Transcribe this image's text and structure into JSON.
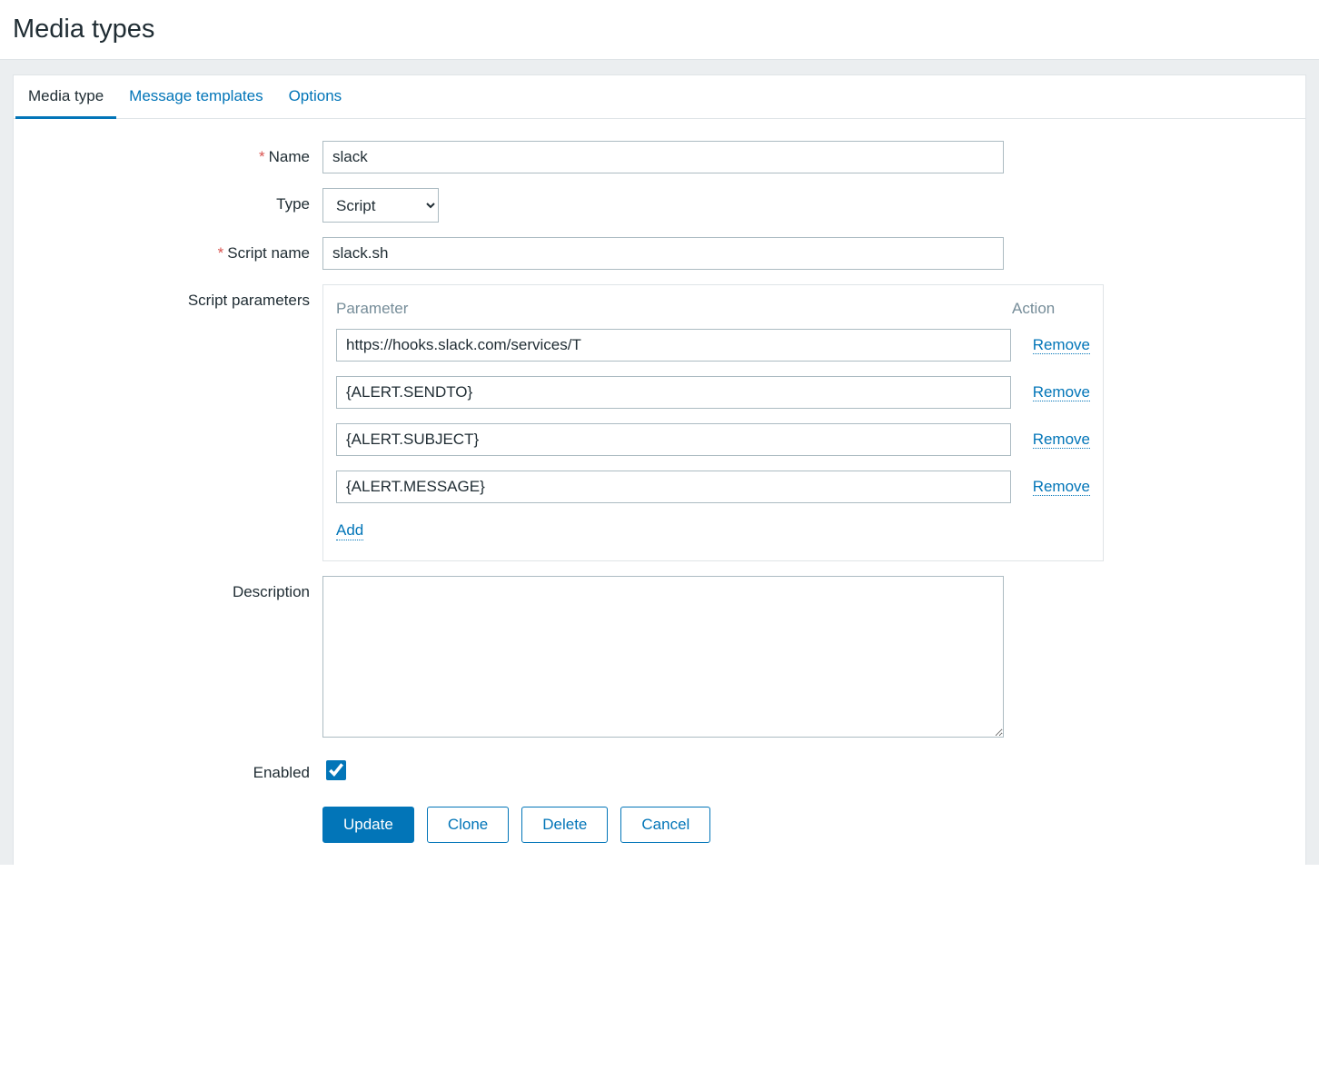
{
  "page": {
    "title": "Media types"
  },
  "tabs": {
    "mediaType": "Media type",
    "msgTemplates": "Message templates",
    "options": "Options"
  },
  "form": {
    "nameLabel": "Name",
    "nameValue": "slack",
    "typeLabel": "Type",
    "typeValue": "Script",
    "scriptNameLabel": "Script name",
    "scriptNameValue": "slack.sh",
    "paramsLabel": "Script parameters",
    "paramsHeaderParam": "Parameter",
    "paramsHeaderAction": "Action",
    "params": [
      "https://hooks.slack.com/services/T",
      "{ALERT.SENDTO}",
      "{ALERT.SUBJECT}",
      "{ALERT.MESSAGE}"
    ],
    "removeLabel": "Remove",
    "addLabel": "Add",
    "descLabel": "Description",
    "descValue": "",
    "enabledLabel": "Enabled",
    "enabledChecked": true
  },
  "buttons": {
    "update": "Update",
    "clone": "Clone",
    "delete": "Delete",
    "cancel": "Cancel"
  }
}
